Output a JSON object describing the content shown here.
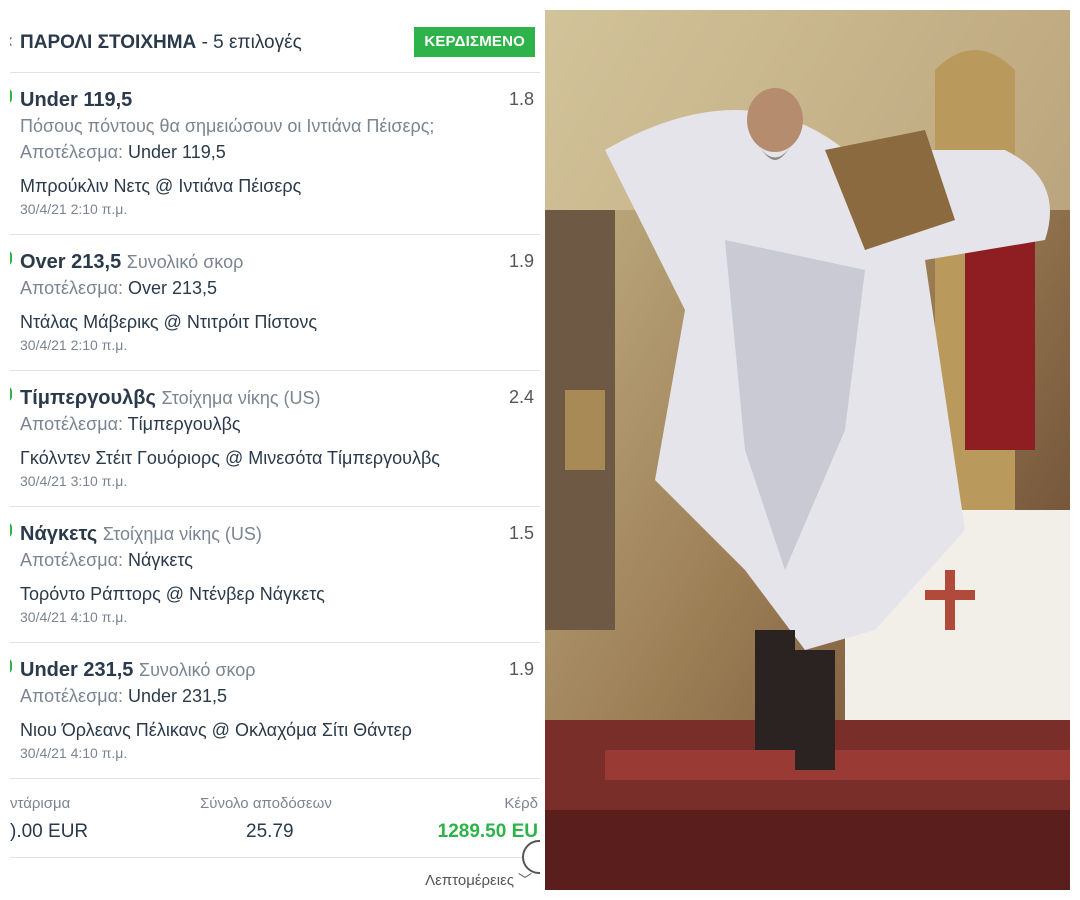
{
  "bet": {
    "title": "ΠΑΡΟΛΙ ΣΤΟΙΧΗΜΑ",
    "subtitle": "- 5 επιλογές",
    "status": "ΚΕΡΔΙΣΜΕΝΟ",
    "selections": [
      {
        "pick": "Under 119,5",
        "market": "",
        "odds": "1.8",
        "question": "Πόσους πόντους θα σημειώσουν οι Ιντιάνα Πέισερς;",
        "result_label": "Αποτέλεσμα:",
        "result": "Under 119,5",
        "event": "Μπρούκλιν Νετς @ Ιντιάνα Πέισερς",
        "date": "30/4/21 2:10 π.μ."
      },
      {
        "pick": "Over 213,5",
        "market": "Συνολικό σκορ",
        "odds": "1.9",
        "question": "",
        "result_label": "Αποτέλεσμα:",
        "result": "Over 213,5",
        "event": "Ντάλας Μάβερικς @ Ντιτρόιτ Πίστονς",
        "date": "30/4/21 2:10 π.μ."
      },
      {
        "pick": "Τίμπεργουλβς",
        "market": "Στοίχημα νίκης (US)",
        "odds": "2.4",
        "question": "",
        "result_label": "Αποτέλεσμα:",
        "result": "Τίμπεργουλβς",
        "event": "Γκόλντεν Στέιτ Γουόριορς @ Μινεσότα Τίμπεργουλβς",
        "date": "30/4/21 3:10 π.μ."
      },
      {
        "pick": "Νάγκετς",
        "market": "Στοίχημα νίκης (US)",
        "odds": "1.5",
        "question": "",
        "result_label": "Αποτέλεσμα:",
        "result": "Νάγκετς",
        "event": "Τορόντο Ράπτορς @ Ντένβερ Νάγκετς",
        "date": "30/4/21 4:10 π.μ."
      },
      {
        "pick": "Under 231,5",
        "market": "Συνολικό σκορ",
        "odds": "1.9",
        "question": "",
        "result_label": "Αποτέλεσμα:",
        "result": "Under 231,5",
        "event": "Νιου Όρλεανς Πέλικανς @ Οκλαχόμα Σίτι Θάντερ",
        "date": "30/4/21 4:10 π.μ."
      }
    ],
    "totals": {
      "stake_label": "ντάρισμα",
      "stake_value": ").00 EUR",
      "odds_label": "Σύνολο αποδόσεων",
      "odds_value": "25.79",
      "win_label": "Κέρδ",
      "win_value": "1289.50 EU"
    },
    "details_label": "Λεπτομέρειες"
  },
  "colors": {
    "accent_green": "#2eb34a",
    "text_dark": "#2a3a4a",
    "text_muted": "#7a8591"
  },
  "photo": {
    "description_icon": "priest-photo"
  }
}
